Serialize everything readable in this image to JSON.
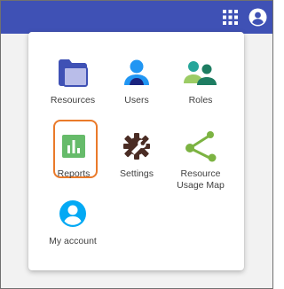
{
  "header": {
    "apps_icon": "grid-icon",
    "account_icon": "account-circle-icon",
    "bar_color": "#3f51b5"
  },
  "menu": {
    "items": [
      {
        "label": "Resources",
        "icon": "folder-icon"
      },
      {
        "label": "Users",
        "icon": "user-icon"
      },
      {
        "label": "Roles",
        "icon": "roles-icon"
      },
      {
        "label": "Reports",
        "icon": "bar-chart-icon",
        "selected": true
      },
      {
        "label": "Settings",
        "icon": "gear-wrench-icon"
      },
      {
        "label": "Resource\nUsage Map",
        "icon": "share-icon"
      },
      {
        "label": "My account",
        "icon": "account-circle-icon"
      }
    ],
    "highlight_color": "#ea7a2a"
  }
}
